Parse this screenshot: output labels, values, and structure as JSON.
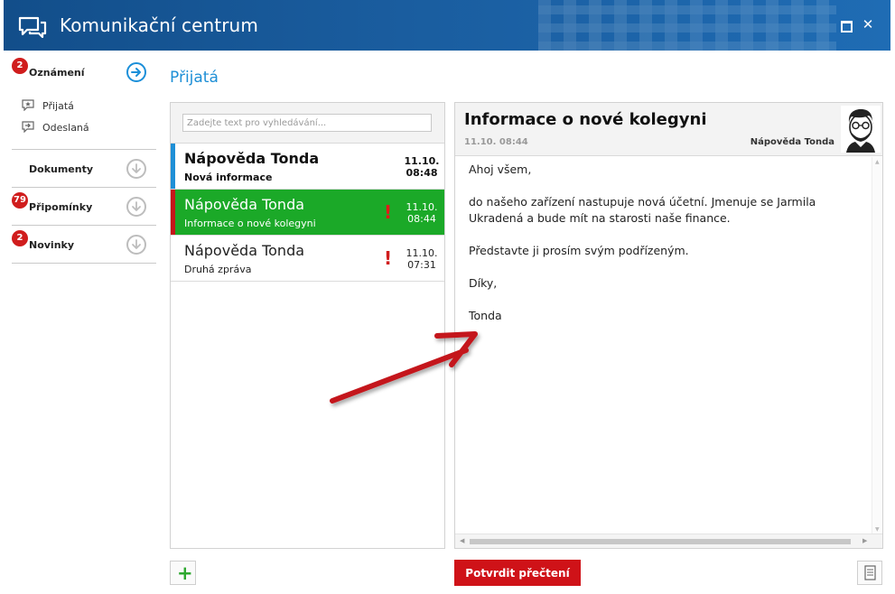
{
  "window": {
    "title": "Komunikační centrum",
    "maximize_icon": "maximize-icon",
    "close_label": "✕"
  },
  "sidebar": {
    "sections": [
      {
        "label": "Oznámení",
        "badge": "2",
        "active": true,
        "items": [
          {
            "label": "Přijatá",
            "icon": "inbox-star-icon"
          },
          {
            "label": "Odeslaná",
            "icon": "outbox-arrow-icon"
          }
        ]
      },
      {
        "label": "Dokumenty",
        "badge": ""
      },
      {
        "label": "Připomínky",
        "badge": "79"
      },
      {
        "label": "Novinky",
        "badge": "2"
      }
    ]
  },
  "main": {
    "section_title": "Přijatá",
    "search": {
      "placeholder": "Zadejte text pro vyhledávání..."
    },
    "messages": [
      {
        "sender": "Nápověda Tonda",
        "subject": "Nová informace",
        "date": "11.10.",
        "time": "08:48",
        "important": false,
        "unread": true
      },
      {
        "sender": "Nápověda Tonda",
        "subject": "Informace o nové kolegyni",
        "date": "11.10.",
        "time": "08:44",
        "important": true,
        "selected": true
      },
      {
        "sender": "Nápověda Tonda",
        "subject": "Druhá zpráva",
        "date": "11.10.",
        "time": "07:31",
        "important": true
      }
    ],
    "important_mark": "!"
  },
  "detail": {
    "title": "Informace o nové kolegyni",
    "date": "11.10. 08:44",
    "from": "Nápověda Tonda",
    "body": {
      "greeting": "Ahoj všem,",
      "paragraph": "do našeho zařízení nastupuje nová účetní. Jmenuje se Jarmila Ukradená a bude mít na starosti naše finance.",
      "request": "Představte ji prosím svým podřízeným.",
      "thanks": "Díky,",
      "signature": "Tonda"
    }
  },
  "footer": {
    "add_label": "+",
    "confirm_label": "Potvrdit přečtení",
    "document_icon": "document-icon"
  },
  "colors": {
    "titlebar": "#1a5d9f",
    "accent_blue": "#1e8fd6",
    "selected_green": "#1ba928",
    "alert_red": "#cf1218"
  }
}
